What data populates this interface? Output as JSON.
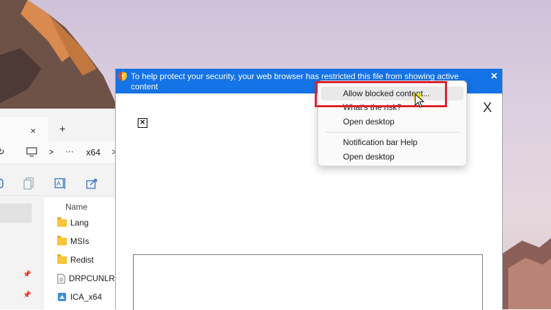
{
  "explorer": {
    "tab_close": "×",
    "new_tab": "+",
    "breadcrumb_more": "···",
    "breadcrumb_sep": ">",
    "breadcrumb_folder": "x64",
    "column_name": "Name",
    "files": [
      {
        "name": "Lang",
        "type": "folder"
      },
      {
        "name": "MSIs",
        "type": "folder"
      },
      {
        "name": "Redist",
        "type": "folder"
      },
      {
        "name": "DRPCUNLR.c",
        "type": "file"
      },
      {
        "name": "ICA_x64",
        "type": "app"
      }
    ]
  },
  "dialog": {
    "infobar_text": "To help protect your security, your web browser has restricted this file from showing active content\nthat could access your computer. Click here for optio",
    "infobar_close": "✕",
    "close": "X",
    "broken_image": "✕"
  },
  "context_menu": {
    "items": [
      "Allow blocked content...",
      "What's the risk?",
      "Open desktop",
      "Notification bar Help",
      "Open desktop"
    ],
    "highlighted_index": 0
  },
  "colors": {
    "infobar": "#1473e6",
    "highlight_box": "#e0202a",
    "cursor_halo": "#f5e400"
  }
}
